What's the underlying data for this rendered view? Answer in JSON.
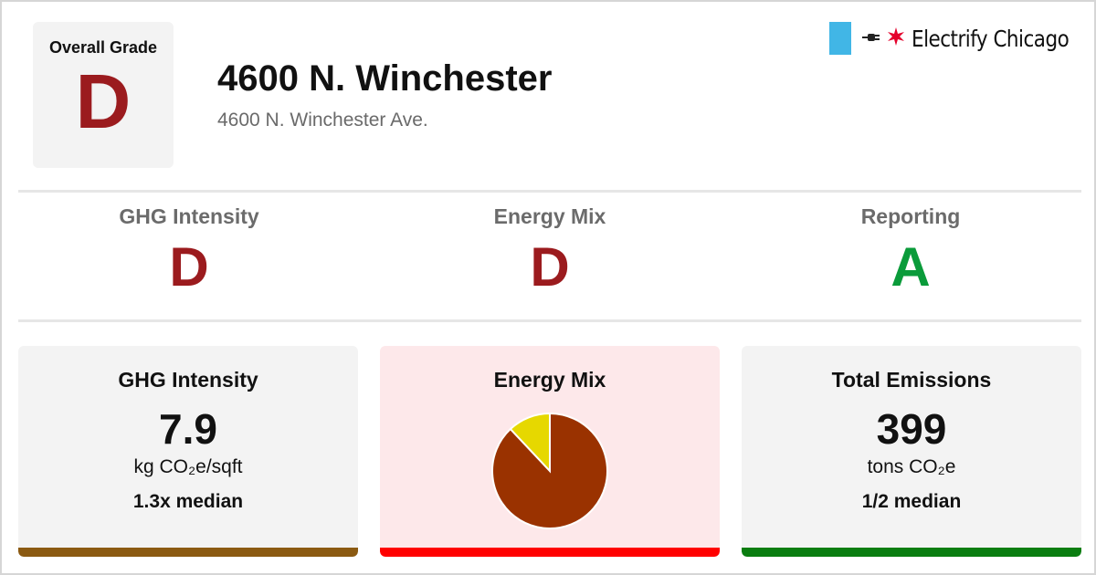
{
  "overall": {
    "label": "Overall Grade",
    "grade": "D",
    "grade_color": "#9b1b1e"
  },
  "building": {
    "title": "4600 N. Winchester",
    "address": "4600 N. Winchester Ave."
  },
  "brand": {
    "name": "Electrify Chicago",
    "icons": [
      "flag-blue-bar-icon",
      "plug-icon",
      "red-star-icon"
    ],
    "colors": {
      "blue": "#41b6e6",
      "star": "#e4002b"
    }
  },
  "sub_grades": [
    {
      "label": "GHG Intensity",
      "grade": "D",
      "color": "#9b1b1e"
    },
    {
      "label": "Energy Mix",
      "grade": "D",
      "color": "#9b1b1e"
    },
    {
      "label": "Reporting",
      "grade": "A",
      "color": "#0a9b3a"
    }
  ],
  "cards": {
    "ghg_intensity": {
      "title": "GHG Intensity",
      "value": "7.9",
      "unit": "kg CO₂e/sqft",
      "median": "1.3x median",
      "bar_color": "#8b5a12",
      "bg_color": "#f3f3f3"
    },
    "energy_mix": {
      "title": "Energy Mix",
      "bar_color": "#ff0000",
      "bg_color": "#fde8ea"
    },
    "total_emissions": {
      "title": "Total Emissions",
      "value": "399",
      "unit": "tons CO₂e",
      "median": "1/2 median",
      "bar_color": "#0a7d10",
      "bg_color": "#f3f3f3"
    }
  },
  "chart_data": {
    "type": "pie",
    "slices": [
      {
        "value": 88,
        "color": "#9a3200"
      },
      {
        "value": 12,
        "color": "#e6d800"
      }
    ]
  }
}
